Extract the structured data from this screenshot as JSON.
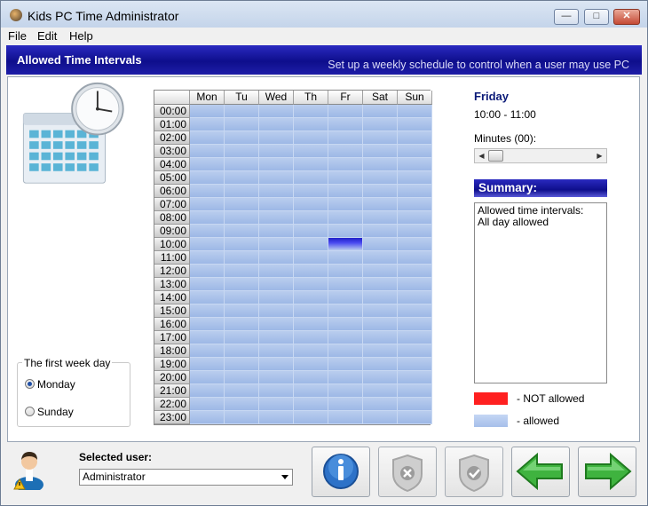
{
  "window": {
    "title": "Kids PC Time Administrator"
  },
  "menu": {
    "items": [
      "File",
      "Edit",
      "Help"
    ]
  },
  "banner": {
    "title": "Allowed Time Intervals",
    "subtitle": "Set up a weekly schedule to control when a user may use PC"
  },
  "schedule": {
    "days": [
      "Mon",
      "Tu",
      "Wed",
      "Th",
      "Fr",
      "Sat",
      "Sun"
    ],
    "hours": [
      "00:00",
      "01:00",
      "02:00",
      "03:00",
      "04:00",
      "05:00",
      "06:00",
      "07:00",
      "08:00",
      "09:00",
      "10:00",
      "11:00",
      "12:00",
      "13:00",
      "14:00",
      "15:00",
      "16:00",
      "17:00",
      "18:00",
      "19:00",
      "20:00",
      "21:00",
      "22:00",
      "23:00"
    ],
    "selected_day": "Fr",
    "selected_hour": "10:00"
  },
  "details": {
    "day": "Friday",
    "time_range": "10:00 - 11:00",
    "minutes_label": "Minutes (00):"
  },
  "summary": {
    "header": "Summary:",
    "line1": "Allowed time intervals:",
    "line2": "All day allowed"
  },
  "legend": {
    "not_allowed": "- NOT allowed",
    "allowed": "- allowed",
    "not_allowed_color": "#ff2020",
    "allowed_color": "#aec6ef"
  },
  "first_week_day": {
    "legend": "The first week day",
    "options": [
      "Monday",
      "Sunday"
    ],
    "selected": "Monday"
  },
  "user": {
    "label": "Selected user:",
    "value": "Administrator"
  },
  "toolbar": {
    "buttons": [
      "info-button",
      "deny-button",
      "allow-button",
      "back-button",
      "forward-button"
    ]
  },
  "colors": {
    "banner": "#14149a",
    "cell_allowed": "#aec6ef",
    "cell_selected": "#2626d0",
    "day_heading": "#0b1a78"
  }
}
